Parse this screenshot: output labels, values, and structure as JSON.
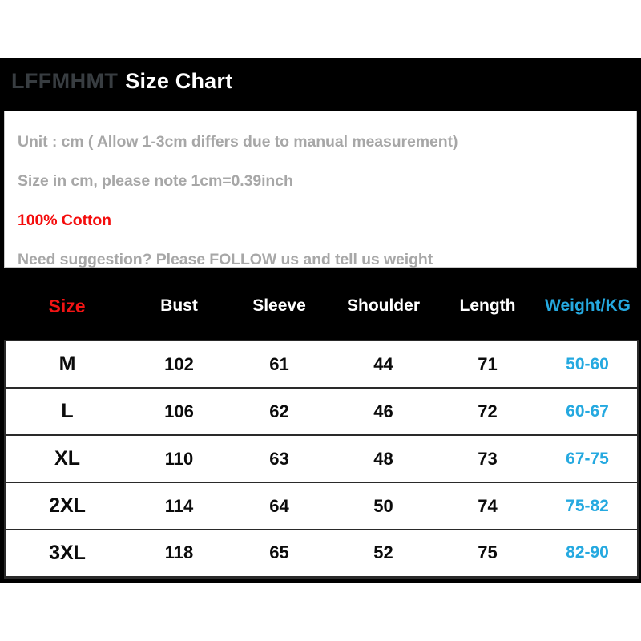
{
  "header": {
    "brand": "LFFMHMT",
    "title": "Size Chart"
  },
  "info": {
    "lines": [
      {
        "text": "Unit : cm ( Allow 1-3cm differs due to manual measurement)",
        "style": "muted"
      },
      {
        "text": "Size in cm, please note 1cm=0.39inch",
        "style": "muted"
      },
      {
        "text": "100% Cotton",
        "style": "accent-red"
      },
      {
        "text": "Need suggestion? Please FOLLOW us and tell us weight",
        "style": "muted"
      }
    ],
    "line_1": "Unit : cm ( Allow 1-3cm differs due to manual measurement)",
    "line_2": "Size in cm, please note 1cm=0.39inch",
    "line_3": "100% Cotton",
    "line_4": "Need suggestion? Please FOLLOW us and tell us weight"
  },
  "table": {
    "columns": [
      "Size",
      "Bust",
      "Sleeve",
      "Shoulder",
      "Length",
      "Weight/KG"
    ],
    "headers": {
      "size": "Size",
      "bust": "Bust",
      "sleeve": "Sleeve",
      "shoulder": "Shoulder",
      "length": "Length",
      "weight": "Weight/KG"
    },
    "rows": [
      {
        "size": "M",
        "bust": "102",
        "sleeve": "61",
        "shoulder": "44",
        "length": "71",
        "weight": "50-60"
      },
      {
        "size": "L",
        "bust": "106",
        "sleeve": "62",
        "shoulder": "46",
        "length": "72",
        "weight": "60-67"
      },
      {
        "size": "XL",
        "bust": "110",
        "sleeve": "63",
        "shoulder": "48",
        "length": "73",
        "weight": "67-75"
      },
      {
        "size": "2XL",
        "bust": "114",
        "sleeve": "64",
        "shoulder": "50",
        "length": "74",
        "weight": "75-82"
      },
      {
        "size": "3XL",
        "bust": "118",
        "sleeve": "65",
        "shoulder": "52",
        "length": "75",
        "weight": "82-90"
      }
    ]
  },
  "colors": {
    "background": "#000000",
    "panel": "#ffffff",
    "accent_red": "#f40d0d",
    "accent_blue": "#25a9e0",
    "muted_text": "#a7a7a7",
    "brand_text": "#383d41",
    "title_text": "#ffffff",
    "cell_text": "#0b0b0b",
    "border": "#2a2a2a"
  }
}
